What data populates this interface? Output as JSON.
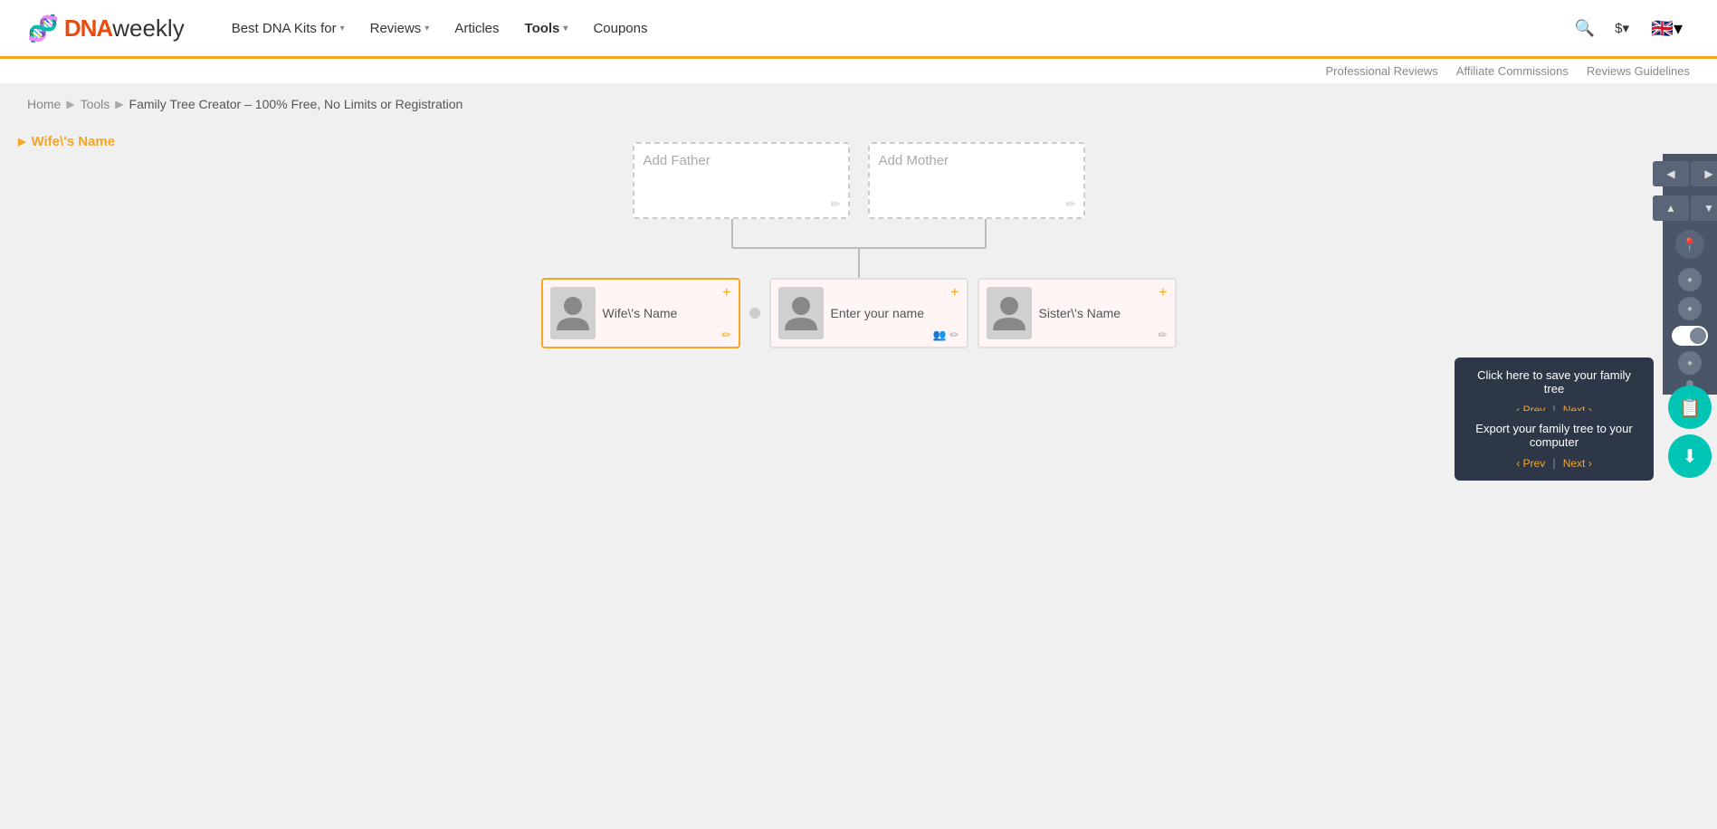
{
  "header": {
    "logo": {
      "dna_text": "DNA",
      "weekly_text": "weekly",
      "icon": "🧬"
    },
    "nav_items": [
      {
        "label": "Best DNA Kits for",
        "has_dropdown": true
      },
      {
        "label": "Reviews",
        "has_dropdown": true
      },
      {
        "label": "Articles",
        "has_dropdown": false
      },
      {
        "label": "Tools",
        "has_dropdown": true,
        "bold": true
      },
      {
        "label": "Coupons",
        "has_dropdown": false
      }
    ],
    "currency": "$",
    "flag": "🇬🇧"
  },
  "sub_nav": {
    "links": [
      {
        "label": "Professional Reviews"
      },
      {
        "label": "Affiliate Commissions"
      },
      {
        "label": "Reviews Guidelines"
      }
    ]
  },
  "breadcrumb": {
    "items": [
      {
        "label": "Home",
        "link": true
      },
      {
        "label": "Tools",
        "link": true
      },
      {
        "label": "Family Tree Creator – 100% Free, No Limits or Registration",
        "link": true
      }
    ]
  },
  "sidebar": {
    "selected_person": "Wife\\'s Name"
  },
  "tree": {
    "father_placeholder": "Add Father",
    "mother_placeholder": "Add Mother",
    "persons": [
      {
        "id": "wife",
        "name": "Wife\\'s Name",
        "selected": true
      },
      {
        "id": "center",
        "name": "Enter your name",
        "selected": false
      },
      {
        "id": "sister",
        "name": "Sister\\'s Name",
        "selected": false
      }
    ]
  },
  "right_panel": {
    "save_tooltip": "Click here to save your family tree",
    "download_tooltip": "Export your family tree to your computer",
    "prev_label": "‹ Prev",
    "next_label": "Next ›",
    "separator": "|"
  }
}
